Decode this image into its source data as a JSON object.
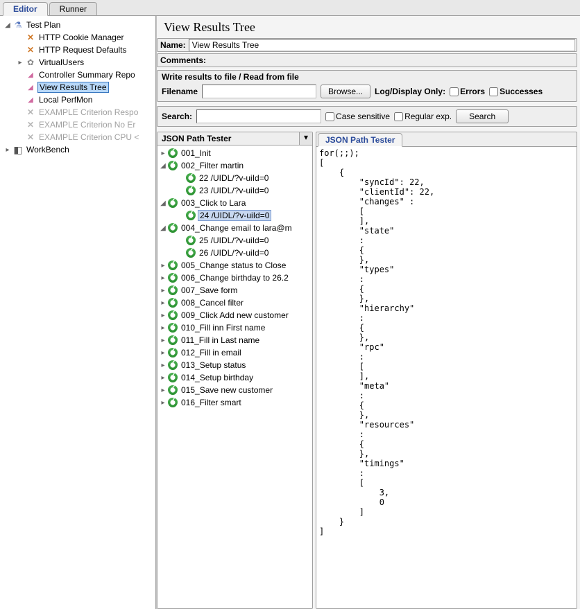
{
  "tabs": {
    "editor": "Editor",
    "runner": "Runner"
  },
  "sidebar": {
    "test_plan": "Test Plan",
    "items": [
      {
        "label": "HTTP Cookie Manager",
        "icon": "wrench"
      },
      {
        "label": "HTTP Request Defaults",
        "icon": "wrench"
      },
      {
        "label": "VirtualUsers",
        "icon": "gear",
        "expandable": true
      },
      {
        "label": "Controller Summary Repo",
        "icon": "chart"
      },
      {
        "label": "View Results Tree",
        "icon": "chart",
        "selected": true
      },
      {
        "label": "Local PerfMon",
        "icon": "chart"
      },
      {
        "label": "EXAMPLE Criterion Respo",
        "icon": "wrench-gray",
        "disabled": true
      },
      {
        "label": "EXAMPLE Criterion No Er",
        "icon": "wrench-gray",
        "disabled": true
      },
      {
        "label": "EXAMPLE Criterion CPU <",
        "icon": "wrench-gray",
        "disabled": true
      }
    ],
    "workbench": "WorkBench"
  },
  "panel": {
    "title": "View Results Tree",
    "name_lbl": "Name:",
    "name_val": "View Results Tree",
    "comments_lbl": "Comments:",
    "file_hdr": "Write results to file / Read from file",
    "filename_lbl": "Filename",
    "browse": "Browse...",
    "logdisplay": "Log/Display Only:",
    "errors": "Errors",
    "successes": "Successes",
    "search_lbl": "Search:",
    "case_sensitive": "Case sensitive",
    "regular_exp": "Regular exp.",
    "search_btn": "Search",
    "combo": "JSON Path Tester",
    "right_tab": "JSON Path Tester"
  },
  "results": [
    {
      "label": "001_Init",
      "collapsed": true
    },
    {
      "label": "002_Filter martin",
      "children": [
        {
          "label": "22 /UIDL/?v-uiId=0"
        },
        {
          "label": "23 /UIDL/?v-uiId=0"
        }
      ]
    },
    {
      "label": "003_Click to Lara",
      "children": [
        {
          "label": "24 /UIDL/?v-uiId=0",
          "selected": true
        }
      ]
    },
    {
      "label": "004_Change email to lara@m",
      "children": [
        {
          "label": "25 /UIDL/?v-uiId=0"
        },
        {
          "label": "26 /UIDL/?v-uiId=0"
        }
      ]
    },
    {
      "label": "005_Change status to Close",
      "collapsed": true
    },
    {
      "label": "006_Change birthday to 26.2",
      "collapsed": true
    },
    {
      "label": "007_Save form",
      "collapsed": true
    },
    {
      "label": "008_Cancel filter",
      "collapsed": true
    },
    {
      "label": "009_Click Add new customer",
      "collapsed": true
    },
    {
      "label": "010_Fill inn First name",
      "collapsed": true
    },
    {
      "label": "011_Fill in Last name",
      "collapsed": true
    },
    {
      "label": "012_Fill in email",
      "collapsed": true
    },
    {
      "label": "013_Setup status",
      "collapsed": true
    },
    {
      "label": "014_Setup birthday",
      "collapsed": true
    },
    {
      "label": "015_Save new customer",
      "collapsed": true
    },
    {
      "label": "016_Filter smart",
      "collapsed": true
    }
  ],
  "json_body": "for(;;);\n[\n    {\n        \"syncId\": 22,\n        \"clientId\": 22,\n        \"changes\" :\n        [\n        ],\n        \"state\"\n        :\n        {\n        },\n        \"types\"\n        :\n        {\n        },\n        \"hierarchy\"\n        :\n        {\n        },\n        \"rpc\"\n        :\n        [\n        ],\n        \"meta\"\n        :\n        {\n        },\n        \"resources\"\n        :\n        {\n        },\n        \"timings\"\n        :\n        [\n            3,\n            0\n        ]\n    }\n]"
}
